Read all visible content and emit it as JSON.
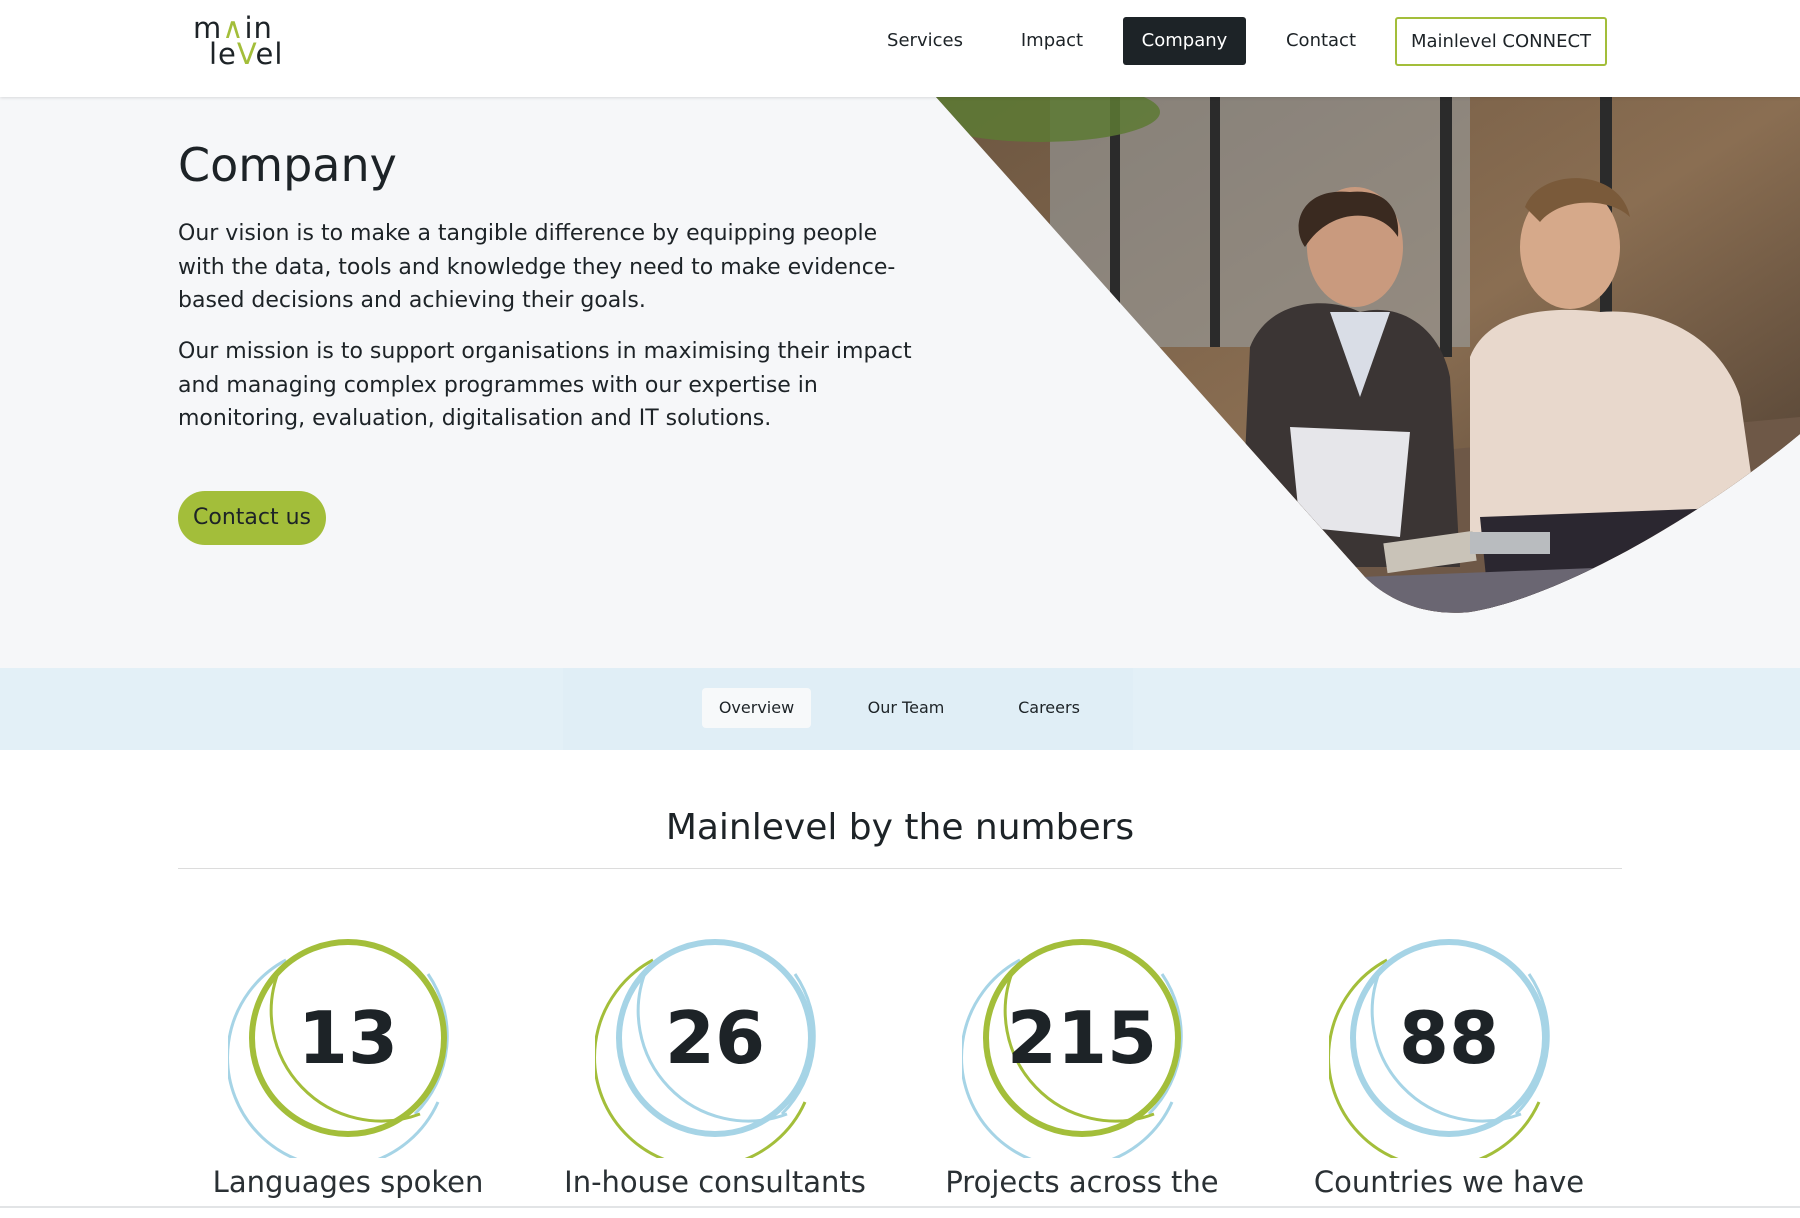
{
  "logo": {
    "line1_a": "m",
    "line1_v": "∧",
    "line1_b": "in",
    "line2_a": "le",
    "line2_v": "V",
    "line2_b": "el"
  },
  "nav": {
    "items": [
      "Services",
      "Impact",
      "Company",
      "Contact"
    ],
    "active": "Company",
    "connect_label": "Mainlevel CONNECT"
  },
  "hero": {
    "title": "Company",
    "paragraph1": "Our vision is to make a tangible difference by equipping people with the data, tools and knowledge they need to make evidence-based decisions and achieving their goals.",
    "paragraph2": "Our mission is to support organisations in maximising their impact and managing complex programmes with our expertise in monitoring, evaluation, digitalisation and IT solutions.",
    "cta_label": "Contact us"
  },
  "subnav": {
    "tabs": [
      "Overview",
      "Our Team",
      "Careers"
    ],
    "active": "Overview"
  },
  "numbers": {
    "title": "Mainlevel by the numbers",
    "stats": [
      {
        "value": "13",
        "label": "Languages spoken",
        "inner_ring": "green"
      },
      {
        "value": "26",
        "label": "In-house consultants",
        "inner_ring": "blue"
      },
      {
        "value": "215",
        "label": "Projects across the",
        "inner_ring": "green"
      },
      {
        "value": "88",
        "label": "Countries we have",
        "inner_ring": "blue"
      }
    ]
  },
  "colors": {
    "accent_green": "#a3be3a",
    "accent_blue": "#a6d4e6",
    "dark": "#1d2327",
    "hero_bg": "#f6f7f9",
    "subnav_bg": "#e3f0f7"
  },
  "icons": [
    "logo",
    "hero-photo",
    "ring-green",
    "ring-blue"
  ]
}
